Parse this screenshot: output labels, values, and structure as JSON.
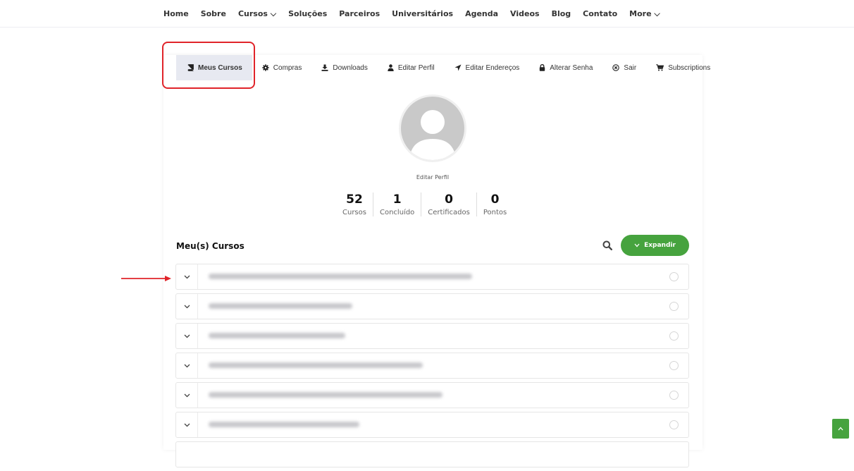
{
  "nav": {
    "items": [
      "Home",
      "Sobre",
      "Cursos ⌵",
      "Soluções",
      "Parceiros",
      "Universitários",
      "Agenda",
      "Videos",
      "Blog",
      "Contato",
      "More ⌵"
    ]
  },
  "tabs": [
    {
      "label": "Meus Cursos",
      "icon": "book-icon",
      "active": true
    },
    {
      "label": "Compras",
      "icon": "gear-icon",
      "active": false
    },
    {
      "label": "Downloads",
      "icon": "download-icon",
      "active": false
    },
    {
      "label": "Editar Perfil",
      "icon": "user-icon",
      "active": false
    },
    {
      "label": "Editar Endereços",
      "icon": "location-arrow-icon",
      "active": false
    },
    {
      "label": "Alterar Senha",
      "icon": "lock-icon",
      "active": false
    },
    {
      "label": "Sair",
      "icon": "close-circle-icon",
      "active": false
    },
    {
      "label": "Subscriptions",
      "icon": "cart-icon",
      "active": false
    }
  ],
  "profile": {
    "edit_label": "Editar Perfil",
    "stats": [
      {
        "value": "52",
        "label": "Cursos"
      },
      {
        "value": "1",
        "label": "Concluído"
      },
      {
        "value": "0",
        "label": "Certificados"
      },
      {
        "value": "0",
        "label": "Pontos"
      }
    ]
  },
  "courses": {
    "title": "Meu(s) Cursos",
    "expand_label": "Expandir",
    "row_count": 6
  },
  "colors": {
    "accent_green": "#46a33e",
    "annotation_red": "#e0242a",
    "active_tab_bg": "#e7e9f1"
  }
}
